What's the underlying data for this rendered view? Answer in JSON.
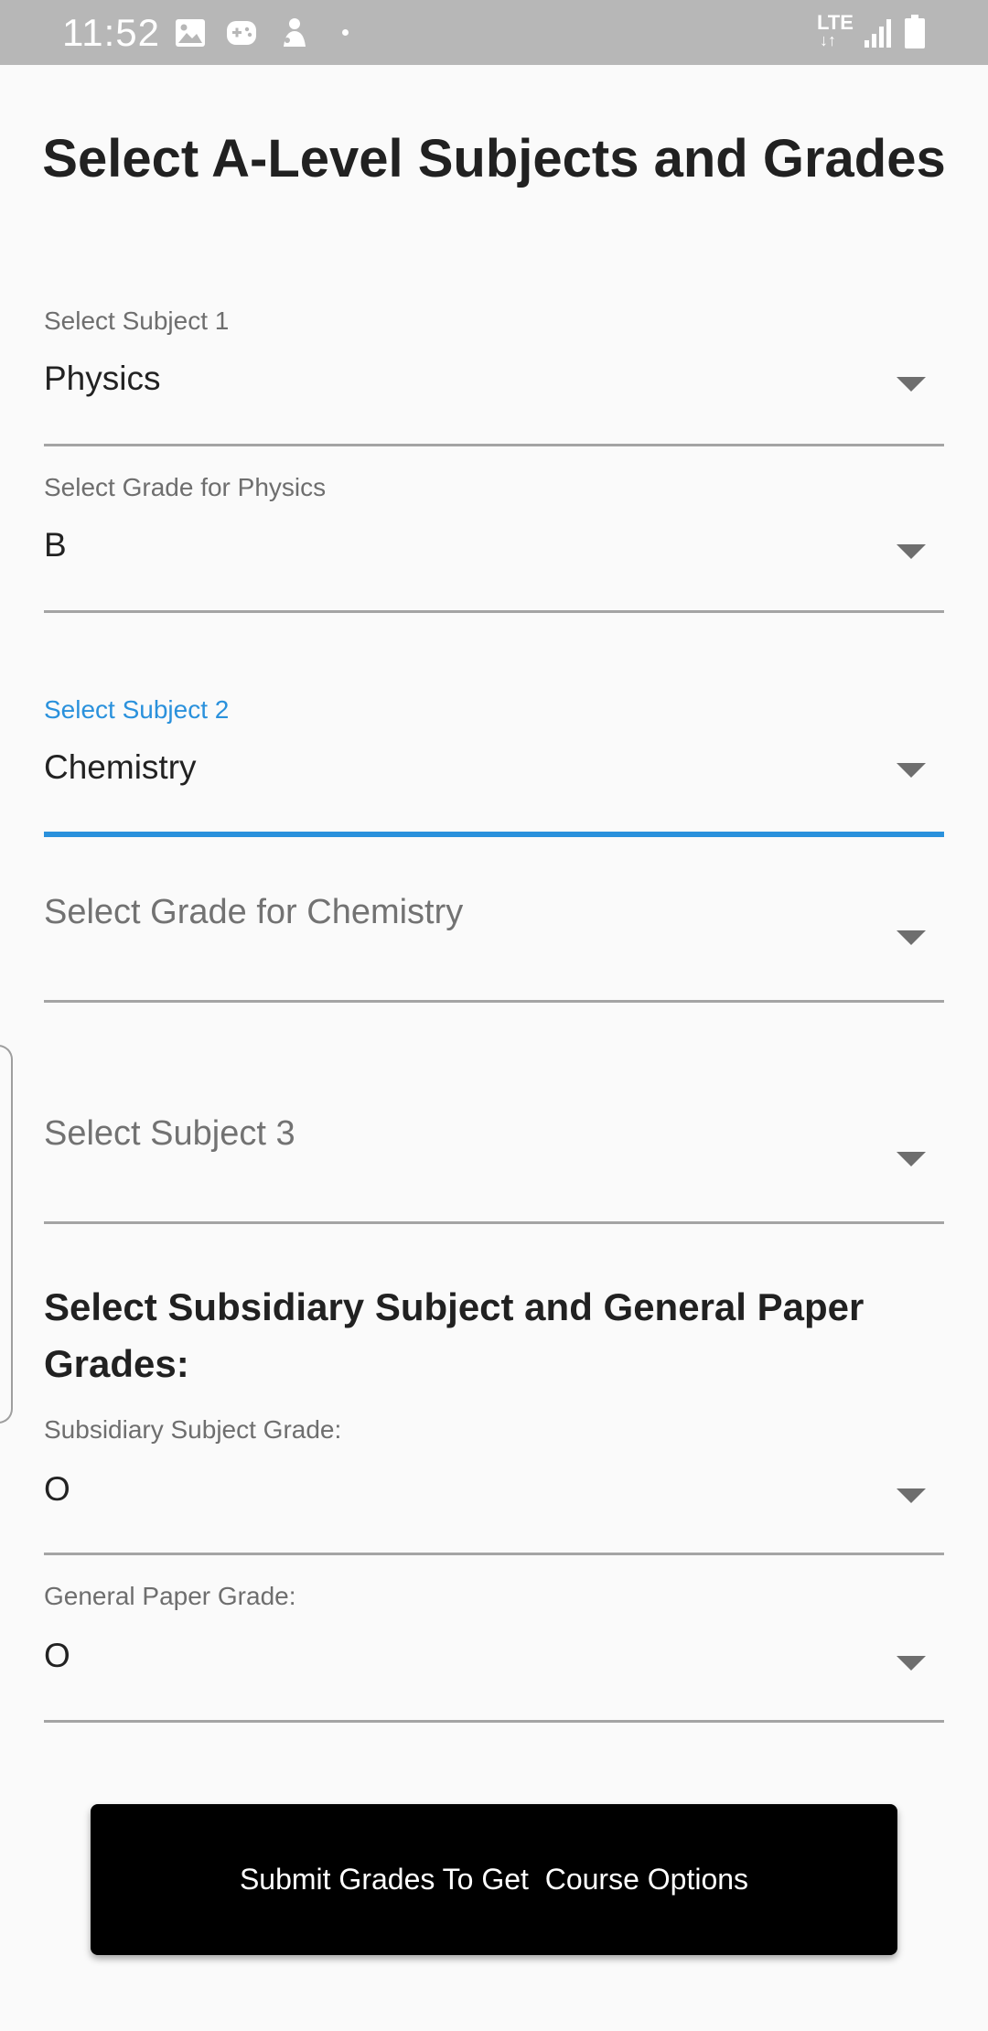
{
  "status_bar": {
    "time": "11:52",
    "icons": [
      "gallery-icon",
      "game-controller-icon",
      "notification-figure-icon",
      "dot-icon"
    ],
    "network": "LTE",
    "right_icons": [
      "lte-icon",
      "signal-icon",
      "battery-icon"
    ]
  },
  "title": "Select A-Level Subjects and Grades",
  "fields": {
    "subject1": {
      "label": "Select Subject 1",
      "value": "Physics"
    },
    "grade1": {
      "label": "Select Grade for Physics",
      "value": "B"
    },
    "subject2": {
      "label": "Select Subject 2",
      "value": "Chemistry"
    },
    "grade2": {
      "placeholder": "Select Grade for Chemistry"
    },
    "subject3": {
      "placeholder": "Select Subject 3"
    }
  },
  "subsidiary": {
    "heading": "Select Subsidiary Subject and General Paper Grades:",
    "subsidiary_grade": {
      "label": "Subsidiary Subject Grade:",
      "value": "O"
    },
    "general_paper_grade": {
      "label": "General Paper Grade:",
      "value": "O"
    }
  },
  "submit_label": "Submit Grades To Get  Course Options",
  "colors": {
    "accent": "#2a91dc",
    "status_bar": "#b7b7b7",
    "button": "#000000",
    "background": "#fafafa"
  }
}
